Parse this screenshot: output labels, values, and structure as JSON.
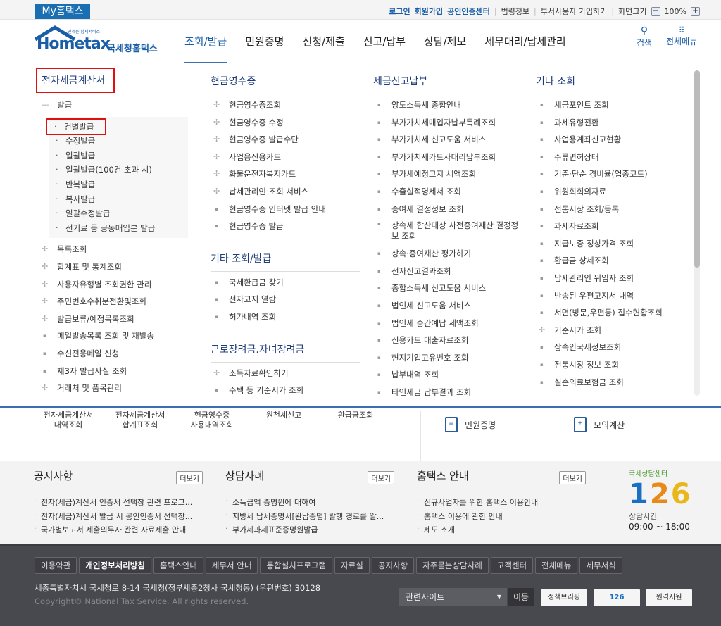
{
  "topbar": {
    "my": "My홈택스",
    "links": [
      "로그인",
      "회원가입",
      "공인인증센터"
    ],
    "links2": [
      "법령정보",
      "부서사용자 가입하기",
      "화면크기"
    ],
    "zoom": "100%"
  },
  "logo": {
    "text": "Hometax",
    "name": "국세청홈택스",
    "tag": "언제든 납세서비스"
  },
  "nav": {
    "items": [
      "조회/발급",
      "민원증명",
      "신청/제출",
      "신고/납부",
      "상담/제보",
      "세무대리/납세관리"
    ],
    "search": "검색",
    "allmenu": "전체메뉴"
  },
  "columns": [
    {
      "title": "전자세금계산서",
      "groups": [
        {
          "label": "발급",
          "type": "minus",
          "sub": [
            "건별발급",
            "수정발급",
            "일괄발급",
            "일괄발급(100건 초과 시)",
            "반복발급",
            "복사발급",
            "일괄수정발급",
            "전기료 등 공동매입분 발급"
          ]
        },
        {
          "items": [
            [
              "목록조회",
              "plus"
            ],
            [
              "합계표 및 통계조회",
              "plus"
            ],
            [
              "사용자유형별 조회권한 관리",
              "plus"
            ],
            [
              "주민번호수취분전환및조회",
              "plus"
            ],
            [
              "발급보류/예정목록조회",
              "plus"
            ],
            [
              "메일발송목록 조회 및 재발송",
              "dot"
            ],
            [
              "수신전용메일 신청",
              "dot"
            ],
            [
              "제3자 발급사실 조회",
              "dot"
            ],
            [
              "거래처 및 품목관리",
              "plus"
            ]
          ]
        }
      ]
    },
    {
      "title": "현금영수증",
      "items": [
        [
          "현금영수증조회",
          "plus"
        ],
        [
          "현금영수증 수정",
          "plus"
        ],
        [
          "현금영수증 발급수단",
          "plus"
        ],
        [
          "사업용신용카드",
          "plus"
        ],
        [
          "화물운전자복지카드",
          "plus"
        ],
        [
          "납세관리인 조회 서비스",
          "plus"
        ],
        [
          "현금영수증 인터넷 발급 안내",
          "dot"
        ],
        [
          "현금영수증 발급",
          "dot"
        ]
      ],
      "more": [
        {
          "title": "기타 조회/발급",
          "items": [
            [
              "국세환급금 찾기",
              "dot"
            ],
            [
              "전자고지 열람",
              "dot"
            ],
            [
              "허가내역 조회",
              "dot"
            ]
          ]
        },
        {
          "title": "근로장려금.자녀장려금",
          "items": [
            [
              "소득자료확인하기",
              "plus"
            ],
            [
              "주택 등 기준시가 조회",
              "dot"
            ]
          ]
        }
      ]
    },
    {
      "title": "세금신고납부",
      "items": [
        [
          "양도소득세 종합안내",
          "dot"
        ],
        [
          "부가가치세매입자납부특례조회",
          "dot"
        ],
        [
          "부가가치세 신고도움 서비스",
          "dot"
        ],
        [
          "부가가치세카드사대리납부조회",
          "dot"
        ],
        [
          "부가세예정고지 세액조회",
          "dot"
        ],
        [
          "수출실적명세서 조회",
          "dot"
        ],
        [
          "증여세 결정정보 조회",
          "dot"
        ],
        [
          "상속세 합산대상 사전증여재산 결정정보 조회",
          "dot two"
        ],
        [
          "상속·증여재산 평가하기",
          "dot"
        ],
        [
          "전자신고결과조회",
          "dot"
        ],
        [
          "종합소득세 신고도움 서비스",
          "dot"
        ],
        [
          "법인세 신고도움 서비스",
          "dot"
        ],
        [
          "법인세 중간예납 세액조회",
          "dot"
        ],
        [
          "신용카드 매출자료조회",
          "dot"
        ],
        [
          "현지기업고유번호 조회",
          "dot"
        ],
        [
          "납부내역 조회",
          "dot"
        ],
        [
          "타인세금 납부결과 조회",
          "dot"
        ]
      ]
    },
    {
      "title": "기타 조회",
      "items": [
        [
          "세금포인트 조회",
          "dot"
        ],
        [
          "과세유형전환",
          "dot"
        ],
        [
          "사업용계좌신고현황",
          "dot"
        ],
        [
          "주류면허상태",
          "dot"
        ],
        [
          "기준·단순 경비율(업종코드)",
          "dot"
        ],
        [
          "위원회회의자료",
          "dot"
        ],
        [
          "전통시장 조회/등록",
          "dot"
        ],
        [
          "과세자료조회",
          "dot"
        ],
        [
          "지급보증 정상가격 조회",
          "dot"
        ],
        [
          "환급금 상세조회",
          "dot"
        ],
        [
          "납세관리인 위임자 조회",
          "dot"
        ],
        [
          "반송된 우편고지서 내역",
          "dot"
        ],
        [
          "서면(방문,우편등) 접수현황조회",
          "dot"
        ],
        [
          "기준시가 조회",
          "plus"
        ],
        [
          "상속인국세정보조회",
          "dot"
        ],
        [
          "전통시장 정보 조회",
          "dot"
        ],
        [
          "실손의료보험금 조회",
          "dot"
        ]
      ]
    }
  ],
  "quick": {
    "links": [
      [
        "전자세금계산서",
        "내역조회"
      ],
      [
        "전자세금계산서",
        "합계표조회"
      ],
      [
        "현금영수증",
        "사용내역조회"
      ],
      [
        "원천세신고",
        ""
      ],
      [
        "환급금조회",
        ""
      ]
    ],
    "right": [
      "민원증명",
      "모의계산"
    ]
  },
  "notice": {
    "more": "더보기",
    "boards": [
      {
        "title": "공지사항",
        "items": [
          "전자(세금)계산서 인증서 선택창 관련 프로그...",
          "전자(세금)계산서 발급 시 공인인증서 선택창...",
          "국가별보고서 제출의무자 관련 자료제출 안내"
        ]
      },
      {
        "title": "상담사례",
        "items": [
          "소득금액 증명원에 대하여",
          "지방세 납세증명서[완납증명] 발행 경로를 알...",
          "부가세과세표준증명원발급"
        ]
      },
      {
        "title": "홈택스 안내",
        "items": [
          "신규사업자를 위한 홈택스 이용안내",
          "홈택스 이용에 관한 안내",
          "제도 소개"
        ]
      }
    ],
    "center": {
      "title": "국세상담센터",
      "number": "126",
      "hours_label": "상담시간",
      "hours": "09:00 ~ 18:00"
    }
  },
  "footer": {
    "links": [
      "이용약관",
      "개인정보처리방침",
      "홈택스안내",
      "세무서 안내",
      "통합설치프로그램",
      "자료실",
      "공지사항",
      "자주묻는상담사례",
      "고객센터",
      "전체메뉴",
      "세무서식"
    ],
    "address": "세종특별자치시 국세청로 8-14 국세청(정부세종2청사 국세청동) (우편번호) 30128",
    "copyright": "Copyright© National Tax Service. All rights reserved.",
    "site_select": "관련사이트",
    "go": "이동",
    "banners": [
      "정책브리핑",
      "126",
      "원격지원"
    ]
  }
}
